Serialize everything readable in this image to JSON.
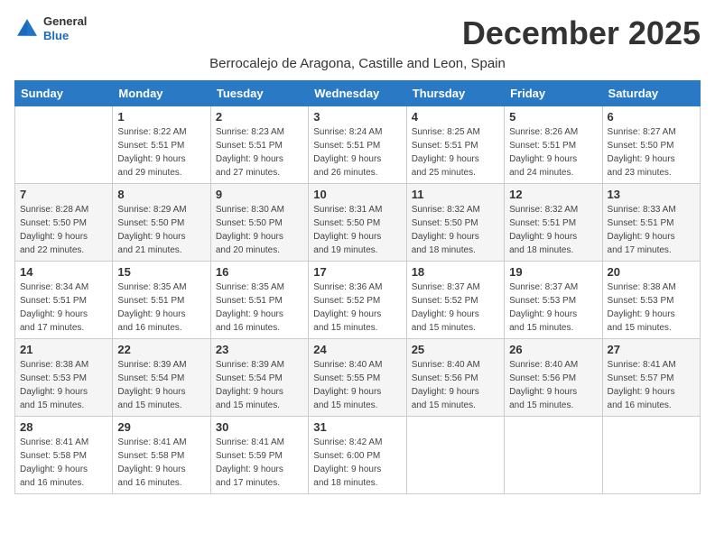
{
  "logo": {
    "general": "General",
    "blue": "Blue"
  },
  "title": "December 2025",
  "subtitle": "Berrocalejo de Aragona, Castille and Leon, Spain",
  "days_of_week": [
    "Sunday",
    "Monday",
    "Tuesday",
    "Wednesday",
    "Thursday",
    "Friday",
    "Saturday"
  ],
  "weeks": [
    [
      {
        "day": "",
        "info": ""
      },
      {
        "day": "1",
        "info": "Sunrise: 8:22 AM\nSunset: 5:51 PM\nDaylight: 9 hours\nand 29 minutes."
      },
      {
        "day": "2",
        "info": "Sunrise: 8:23 AM\nSunset: 5:51 PM\nDaylight: 9 hours\nand 27 minutes."
      },
      {
        "day": "3",
        "info": "Sunrise: 8:24 AM\nSunset: 5:51 PM\nDaylight: 9 hours\nand 26 minutes."
      },
      {
        "day": "4",
        "info": "Sunrise: 8:25 AM\nSunset: 5:51 PM\nDaylight: 9 hours\nand 25 minutes."
      },
      {
        "day": "5",
        "info": "Sunrise: 8:26 AM\nSunset: 5:51 PM\nDaylight: 9 hours\nand 24 minutes."
      },
      {
        "day": "6",
        "info": "Sunrise: 8:27 AM\nSunset: 5:50 PM\nDaylight: 9 hours\nand 23 minutes."
      }
    ],
    [
      {
        "day": "7",
        "info": "Sunrise: 8:28 AM\nSunset: 5:50 PM\nDaylight: 9 hours\nand 22 minutes."
      },
      {
        "day": "8",
        "info": "Sunrise: 8:29 AM\nSunset: 5:50 PM\nDaylight: 9 hours\nand 21 minutes."
      },
      {
        "day": "9",
        "info": "Sunrise: 8:30 AM\nSunset: 5:50 PM\nDaylight: 9 hours\nand 20 minutes."
      },
      {
        "day": "10",
        "info": "Sunrise: 8:31 AM\nSunset: 5:50 PM\nDaylight: 9 hours\nand 19 minutes."
      },
      {
        "day": "11",
        "info": "Sunrise: 8:32 AM\nSunset: 5:50 PM\nDaylight: 9 hours\nand 18 minutes."
      },
      {
        "day": "12",
        "info": "Sunrise: 8:32 AM\nSunset: 5:51 PM\nDaylight: 9 hours\nand 18 minutes."
      },
      {
        "day": "13",
        "info": "Sunrise: 8:33 AM\nSunset: 5:51 PM\nDaylight: 9 hours\nand 17 minutes."
      }
    ],
    [
      {
        "day": "14",
        "info": "Sunrise: 8:34 AM\nSunset: 5:51 PM\nDaylight: 9 hours\nand 17 minutes."
      },
      {
        "day": "15",
        "info": "Sunrise: 8:35 AM\nSunset: 5:51 PM\nDaylight: 9 hours\nand 16 minutes."
      },
      {
        "day": "16",
        "info": "Sunrise: 8:35 AM\nSunset: 5:51 PM\nDaylight: 9 hours\nand 16 minutes."
      },
      {
        "day": "17",
        "info": "Sunrise: 8:36 AM\nSunset: 5:52 PM\nDaylight: 9 hours\nand 15 minutes."
      },
      {
        "day": "18",
        "info": "Sunrise: 8:37 AM\nSunset: 5:52 PM\nDaylight: 9 hours\nand 15 minutes."
      },
      {
        "day": "19",
        "info": "Sunrise: 8:37 AM\nSunset: 5:53 PM\nDaylight: 9 hours\nand 15 minutes."
      },
      {
        "day": "20",
        "info": "Sunrise: 8:38 AM\nSunset: 5:53 PM\nDaylight: 9 hours\nand 15 minutes."
      }
    ],
    [
      {
        "day": "21",
        "info": "Sunrise: 8:38 AM\nSunset: 5:53 PM\nDaylight: 9 hours\nand 15 minutes."
      },
      {
        "day": "22",
        "info": "Sunrise: 8:39 AM\nSunset: 5:54 PM\nDaylight: 9 hours\nand 15 minutes."
      },
      {
        "day": "23",
        "info": "Sunrise: 8:39 AM\nSunset: 5:54 PM\nDaylight: 9 hours\nand 15 minutes."
      },
      {
        "day": "24",
        "info": "Sunrise: 8:40 AM\nSunset: 5:55 PM\nDaylight: 9 hours\nand 15 minutes."
      },
      {
        "day": "25",
        "info": "Sunrise: 8:40 AM\nSunset: 5:56 PM\nDaylight: 9 hours\nand 15 minutes."
      },
      {
        "day": "26",
        "info": "Sunrise: 8:40 AM\nSunset: 5:56 PM\nDaylight: 9 hours\nand 15 minutes."
      },
      {
        "day": "27",
        "info": "Sunrise: 8:41 AM\nSunset: 5:57 PM\nDaylight: 9 hours\nand 16 minutes."
      }
    ],
    [
      {
        "day": "28",
        "info": "Sunrise: 8:41 AM\nSunset: 5:58 PM\nDaylight: 9 hours\nand 16 minutes."
      },
      {
        "day": "29",
        "info": "Sunrise: 8:41 AM\nSunset: 5:58 PM\nDaylight: 9 hours\nand 16 minutes."
      },
      {
        "day": "30",
        "info": "Sunrise: 8:41 AM\nSunset: 5:59 PM\nDaylight: 9 hours\nand 17 minutes."
      },
      {
        "day": "31",
        "info": "Sunrise: 8:42 AM\nSunset: 6:00 PM\nDaylight: 9 hours\nand 18 minutes."
      },
      {
        "day": "",
        "info": ""
      },
      {
        "day": "",
        "info": ""
      },
      {
        "day": "",
        "info": ""
      }
    ]
  ]
}
